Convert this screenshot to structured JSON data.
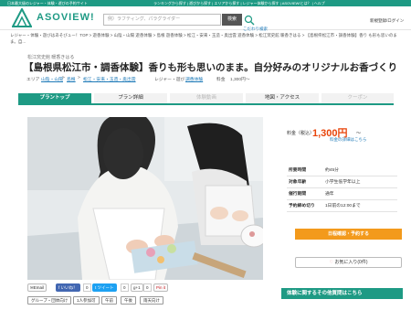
{
  "topbar": {
    "left": "日本最大級のレジャー・体験・遊びの予約サイト",
    "right": "ランキングから探す | 遊びから探す | エリアから探す | レジャー体験から探す | ASOVIEW!とは？ | ヘルプ"
  },
  "header": {
    "logo_text": "ASOVIEW!",
    "search_placeholder": "例）ラフティング、パラグライダー",
    "search_button": "検索",
    "search_link": "こだわり検索",
    "login": "新規登録/ログイン"
  },
  "breadcrumb": "レジャー・体験・遊びはあそびュー！TOP > 遊香体験 > 山陰・山陽 遊香体験 > 島根 遊香体験 > 松江・安来・玉造・奥出雲 遊香体験 > 松江窯史館 暖香きはる > 【島根県松江市・調香体験】香り も形も思いのまま。自...",
  "shop_name": "松江窯史館 暖香きはる",
  "title": "【島根県松江市・調香体験】香りも形も思いのまま。自分好みのオリジナルお香づくり",
  "meta": {
    "area_label": "エリア",
    "area_parts": [
      "山陰・山陽",
      "島根",
      "松江・安来・玉造・奥出雲"
    ],
    "category_label": "レジャー・遊び",
    "category": "調香体験",
    "price_label": "料金",
    "price_text": "1,300円〜"
  },
  "tabs": [
    {
      "label": "プラントップ",
      "state": "active"
    },
    {
      "label": "プラン詳細",
      "state": "normal"
    },
    {
      "label": "体験動画",
      "state": "disabled"
    },
    {
      "label": "地図・アクセス",
      "state": "normal"
    },
    {
      "label": "クーポン",
      "state": "disabled"
    }
  ],
  "share": {
    "email": "Email",
    "like": "いいね！",
    "like_count": "0",
    "tweet": "ツイート",
    "tweet_count": "0",
    "gplus": "g+1",
    "gplus_count": "0",
    "pin": "Pin it"
  },
  "tags": [
    "グループ・団体向け",
    "1人参加可",
    "午前",
    "午後",
    "雨天向け"
  ],
  "price": {
    "label": "料金（税込）",
    "value": "1,300円",
    "unit": "〜",
    "detail_link": "料金の詳細はこちら"
  },
  "info": [
    {
      "k": "所要時間",
      "v": "約45分"
    },
    {
      "k": "対象年齢",
      "v": "小学生低学年以上"
    },
    {
      "k": "催行期間",
      "v": "通年"
    },
    {
      "k": "予約締め切り",
      "v": "1日前の12:00まで"
    }
  ],
  "reserve_button": "日程確認・予約する",
  "fav_button": "お気に入り(0件)",
  "voice_bar": "体験に関するその他質問はこちら",
  "colors": {
    "brand": "#1e9a84",
    "price": "#e8440a",
    "reserve": "#f39a1c",
    "link": "#1e7ab8"
  }
}
